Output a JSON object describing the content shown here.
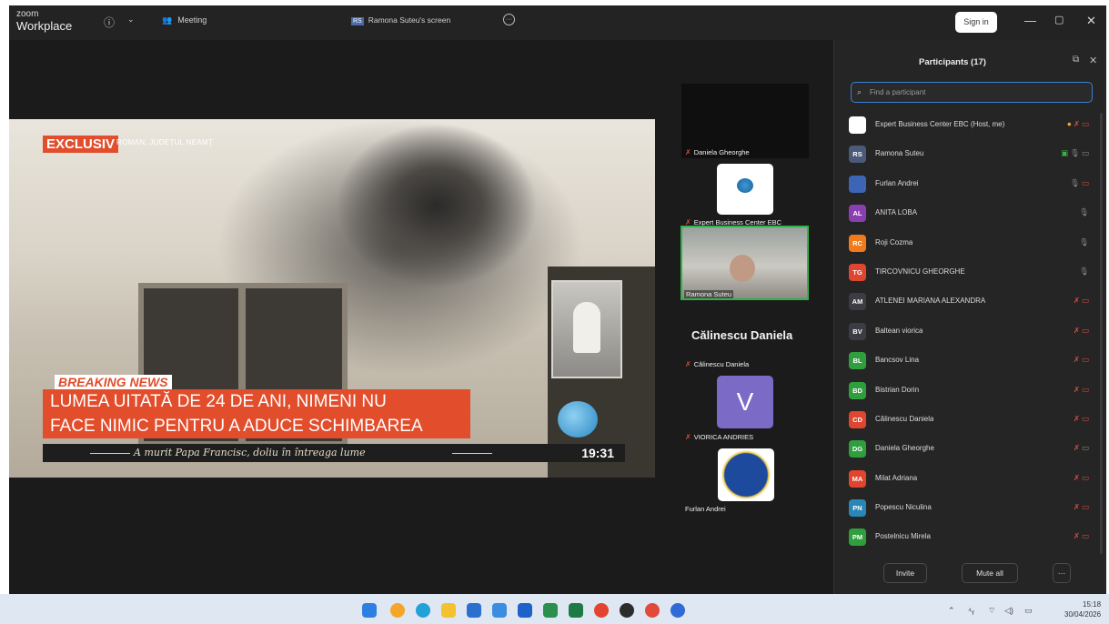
{
  "window": {
    "brand_small": "zoom",
    "brand_large": "Workplace",
    "meeting_tab": "Meeting",
    "screen_tab_badge": "RS",
    "screen_tab": "Ramona Suteu's screen",
    "sign_in": "Sign in"
  },
  "shared_screen": {
    "exclusiv": "EXCLUSIV",
    "region": "ROMAN, JUDEȚUL NEAMȚ",
    "breaking": "BREAKING NEWS",
    "headline_line1": "LUMEA UITATĂ DE 24 DE ANI, NIMENI NU",
    "headline_line2": "FACE NIMIC PENTRU A ADUCE SCHIMBAREA",
    "ticker": "A murit Papa Francisc, doliu în întreaga lume",
    "clock": "19:31"
  },
  "video_strip": {
    "tile1_name": "Daniela Gheorghe",
    "tile2_name": "Expert Business Center EBC",
    "tile3_name": "Ramona Suteu",
    "big_name": "Călinescu Daniela",
    "tile4_name": "Călinescu Daniela",
    "tile5_letter": "V",
    "tile5_name": "VIORICA ANDRIES",
    "tile6_name": "Furlan Andrei"
  },
  "participants": {
    "title": "Participants (17)",
    "search_placeholder": "Find a participant",
    "invite": "Invite",
    "mute_all": "Mute all",
    "more": "···",
    "rows": [
      {
        "initials": "",
        "name": "Expert Business Center EBC (Host, me)",
        "color": "#ffffff",
        "icons": "host"
      },
      {
        "initials": "RS",
        "name": "Ramona Suteu",
        "color": "#4a5a78",
        "icons": "share"
      },
      {
        "initials": "",
        "name": "Furlan Andrei",
        "color": "#3c66b5",
        "icons": "mic-video-off"
      },
      {
        "initials": "AL",
        "name": "ANITA LOBA",
        "color": "#8a3fb0",
        "icons": "mic"
      },
      {
        "initials": "RC",
        "name": "Roji Cozma",
        "color": "#f07a1c",
        "icons": "mic"
      },
      {
        "initials": "TG",
        "name": "TIRCOVNICU GHEORGHE",
        "color": "#e0452f",
        "icons": "mic"
      },
      {
        "initials": "AM",
        "name": "ATLENEI MARIANA ALEXANDRA",
        "color": "#3c3c44",
        "icons": "off-off"
      },
      {
        "initials": "BV",
        "name": "Baltean viorica",
        "color": "#3c3c44",
        "icons": "off-off"
      },
      {
        "initials": "BL",
        "name": "Bancsov Lina",
        "color": "#2f9f3e",
        "icons": "off-off"
      },
      {
        "initials": "BD",
        "name": "Bistrian Dorin",
        "color": "#2f9f3e",
        "icons": "off-off"
      },
      {
        "initials": "CD",
        "name": "Călinescu Daniela",
        "color": "#e0452f",
        "icons": "off-off"
      },
      {
        "initials": "DG",
        "name": "Daniela Gheorghe",
        "color": "#2f9f3e",
        "icons": "off-video"
      },
      {
        "initials": "MA",
        "name": "Milat Adriana",
        "color": "#e0452f",
        "icons": "off-off"
      },
      {
        "initials": "PN",
        "name": "Popescu Niculina",
        "color": "#2b86b8",
        "icons": "off-off"
      },
      {
        "initials": "PM",
        "name": "Postelnicu Mirela",
        "color": "#2f9f3e",
        "icons": "off-off"
      }
    ]
  },
  "taskbar": {
    "time": "15:18",
    "date": "30/04/2026"
  }
}
